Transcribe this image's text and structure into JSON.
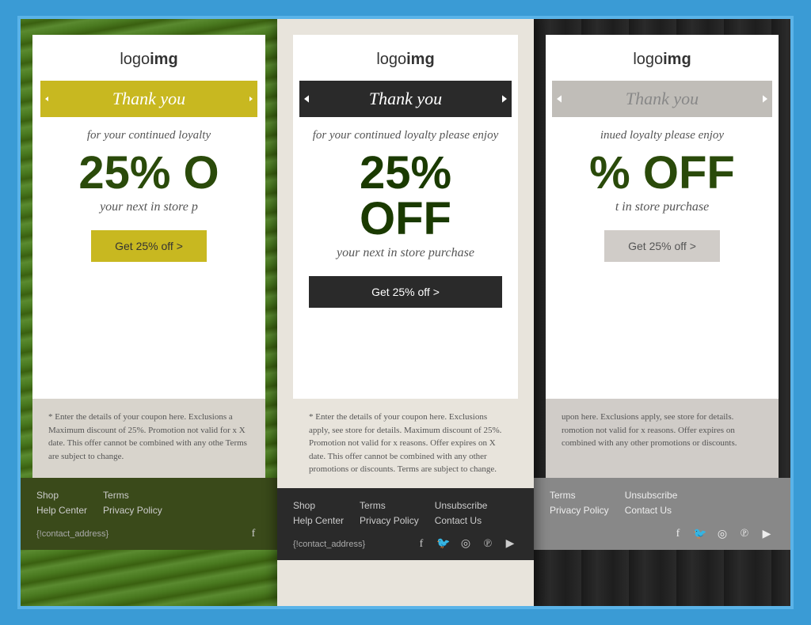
{
  "cards": [
    {
      "id": "card-1",
      "theme": "green",
      "logo": {
        "text_plain": "logo",
        "text_bold": "img"
      },
      "banner": {
        "text": "Thank you",
        "color": "yellow"
      },
      "loyalty_text": "for your continued loyalty",
      "discount": "25% O",
      "store_text": "your next in store p",
      "cta_label": "Get 25% off >",
      "fine_print": "* Enter the details of your coupon here. Exclusions a Maximum discount of 25%. Promotion not valid for x X date. This offer cannot be combined with any othe Terms are subject to change.",
      "footer": {
        "cols": [
          [
            "Shop",
            "Help Center"
          ],
          [
            "Terms",
            "Privacy Policy"
          ]
        ],
        "contact_address": "{!contact_address}",
        "social": [
          "f"
        ]
      }
    },
    {
      "id": "card-2",
      "theme": "dark",
      "logo": {
        "text_plain": "logo",
        "text_bold": "img"
      },
      "banner": {
        "text": "Thank you",
        "color": "dark"
      },
      "loyalty_text": "for your continued loyalty please enjoy",
      "discount": "25% OFF",
      "store_text": "your next in store purchase",
      "cta_label": "Get 25% off >",
      "fine_print": "* Enter the details of your coupon here. Exclusions apply, see store for details. Maximum discount of 25%. Promotion not valid for x reasons. Offer expires on X date. This offer cannot be combined with any other promotions or discounts. Terms are subject to change.",
      "footer": {
        "cols": [
          [
            "Shop",
            "Help Center"
          ],
          [
            "Terms",
            "Privacy Policy"
          ],
          [
            "Unsubscribe",
            "Contact Us"
          ]
        ],
        "contact_address": "{!contact_address}",
        "social": [
          "f",
          "t",
          "ig",
          "p",
          "yt"
        ]
      }
    },
    {
      "id": "card-3",
      "theme": "gray",
      "logo": {
        "text_plain": "logo",
        "text_bold": "img"
      },
      "banner": {
        "text": "Thank you",
        "color": "gray"
      },
      "loyalty_text": "inued loyalty please enjoy",
      "discount": "% OFF",
      "store_text": "t in store purchase",
      "cta_label": "Get 25% off >",
      "fine_print": "upon here. Exclusions apply, see store for details. romotion not valid for x reasons. Offer expires on combined with any other promotions or discounts.",
      "footer": {
        "cols": [
          [
            "Terms",
            "Privacy Policy"
          ],
          [
            "Unsubscribe",
            "Contact Us"
          ]
        ],
        "contact_address": "",
        "social": [
          "f",
          "t",
          "ig",
          "p",
          "yt"
        ]
      }
    }
  ],
  "social_icons": {
    "f": "f",
    "t": "🐦",
    "ig": "📷",
    "p": "𝗽",
    "yt": "▶"
  }
}
